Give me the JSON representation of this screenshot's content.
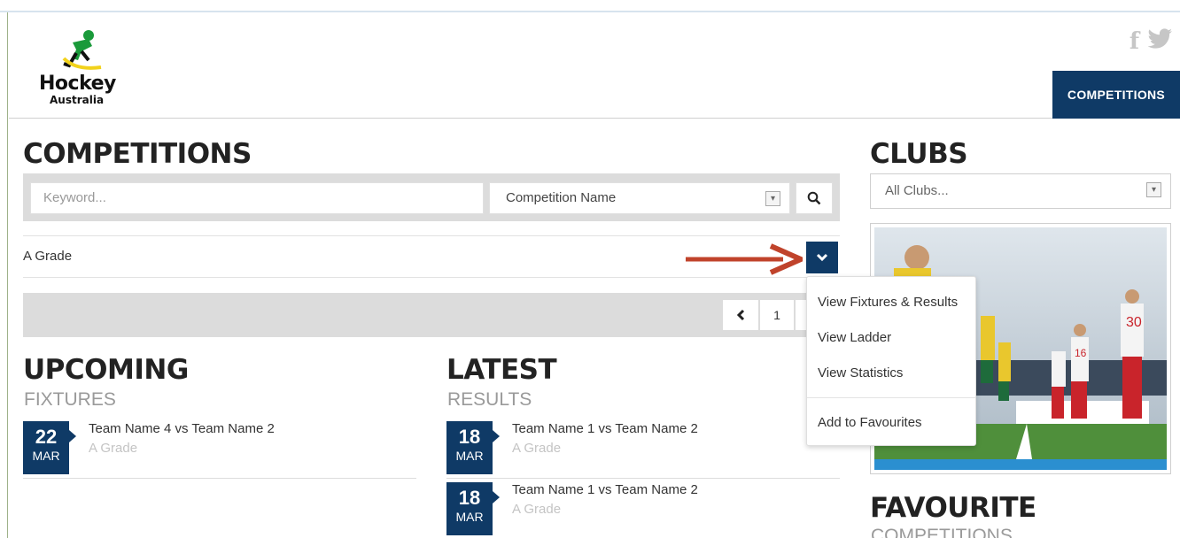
{
  "header": {
    "logo_text": "Hockey",
    "logo_sub": "Australia",
    "social": [
      "f",
      "t"
    ],
    "nav_label": "COMPETITIONS"
  },
  "competitions": {
    "title": "COMPETITIONS",
    "keyword_placeholder": "Keyword...",
    "select_value": "Competition Name",
    "selected_grade": "A Grade",
    "page_number": "1"
  },
  "dropdown": {
    "items": [
      "View Fixtures & Results",
      "View Ladder",
      "View Statistics",
      "Add to Favourites"
    ]
  },
  "upcoming": {
    "title": "UPCOMING",
    "subtitle": "FIXTURES",
    "items": [
      {
        "day": "22",
        "month": "MAR",
        "title": "Team Name 4 vs Team Name 2",
        "grade": "A Grade"
      }
    ]
  },
  "latest": {
    "title": "LATEST",
    "subtitle": "RESULTS",
    "items": [
      {
        "day": "18",
        "month": "MAR",
        "title": "Team Name 1 vs Team Name 2",
        "grade": "A Grade"
      },
      {
        "day": "18",
        "month": "MAR",
        "title": "Team Name 1 vs Team Name 2",
        "grade": "A Grade"
      }
    ]
  },
  "clubs": {
    "title": "CLUBS",
    "select_value": "All Clubs..."
  },
  "favourite": {
    "title": "FAVOURITE",
    "subtitle": "COMPETITIONS"
  },
  "colors": {
    "brand": "#0f3a66",
    "arrow": "#c0432b"
  },
  "photo": {
    "jersey_numbers": [
      "30",
      "16"
    ]
  }
}
